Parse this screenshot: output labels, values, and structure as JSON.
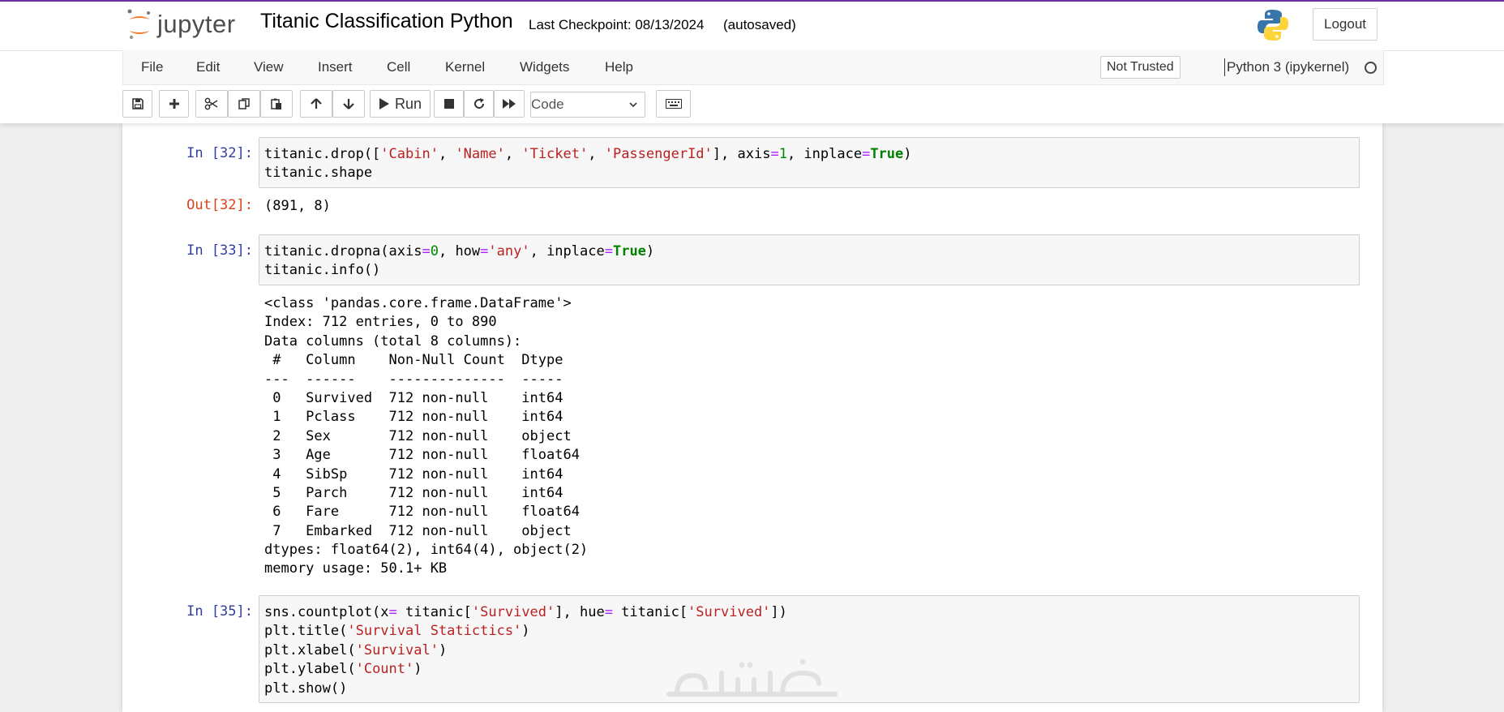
{
  "header": {
    "logo_text": "jupyter",
    "notebook_title": "Titanic Classification Python",
    "checkpoint": "Last Checkpoint: 08/13/2024",
    "save_status": "(autosaved)",
    "logout_label": "Logout"
  },
  "menu": {
    "items": [
      "File",
      "Edit",
      "View",
      "Insert",
      "Cell",
      "Kernel",
      "Widgets",
      "Help"
    ],
    "trust_label": "Not Trusted",
    "kernel_name": "Python 3 (ipykernel)"
  },
  "toolbar": {
    "run_label": "Run",
    "cell_type": "Code",
    "icons": [
      "save-icon",
      "plus-icon",
      "cut-icon",
      "copy-icon",
      "paste-icon",
      "arrow-up-icon",
      "arrow-down-icon",
      "run-icon",
      "stop-icon",
      "restart-icon",
      "fast-forward-icon",
      "keyboard-icon"
    ]
  },
  "cells": {
    "c32": {
      "in_prompt": "In [32]:",
      "code": {
        "l1": {
          "a": "titanic.drop([",
          "b": "'Cabin'",
          "c": ", ",
          "d": "'Name'",
          "e": ", ",
          "f": "'Ticket'",
          "g": ", ",
          "h": "'PassengerId'",
          "i": "], axis",
          "j": "=",
          "k": "1",
          "l": ", inplace",
          "m": "=",
          "n": "True",
          "o": ")"
        },
        "l2": "titanic.shape"
      },
      "out_prompt": "Out[32]:",
      "output": "(891, 8)"
    },
    "c33": {
      "in_prompt": "In [33]:",
      "code": {
        "l1": {
          "a": "titanic.dropna(axis",
          "b": "=",
          "c": "0",
          "d": ", how",
          "e": "=",
          "f": "'any'",
          "g": ", inplace",
          "h": "=",
          "i": "True",
          "j": ")"
        },
        "l2": "titanic.info()"
      },
      "output_lines": [
        "<class 'pandas.core.frame.DataFrame'>",
        "Index: 712 entries, 0 to 890",
        "Data columns (total 8 columns):",
        " #   Column    Non-Null Count  Dtype  ",
        "---  ------    --------------  -----  ",
        " 0   Survived  712 non-null    int64  ",
        " 1   Pclass    712 non-null    int64  ",
        " 2   Sex       712 non-null    object ",
        " 3   Age       712 non-null    float64",
        " 4   SibSp     712 non-null    int64  ",
        " 5   Parch     712 non-null    int64  ",
        " 6   Fare      712 non-null    float64",
        " 7   Embarked  712 non-null    object ",
        "dtypes: float64(2), int64(4), object(2)",
        "memory usage: 50.1+ KB"
      ]
    },
    "c35": {
      "in_prompt": "In [35]:",
      "code": {
        "l1": {
          "a": "sns.countplot(x",
          "b": "=",
          "c": " titanic[",
          "d": "'Survived'",
          "e": "], hue",
          "f": "=",
          "g": " titanic[",
          "h": "'Survived'",
          "i": "])"
        },
        "l2": {
          "a": "plt.title(",
          "b": "'Survival Statictics'",
          "c": ")"
        },
        "l3": {
          "a": "plt.xlabel(",
          "b": "'Survival'",
          "c": ")"
        },
        "l4": {
          "a": "plt.ylabel(",
          "b": "'Count'",
          "c": ")"
        },
        "l5": "plt.show()"
      }
    }
  },
  "colors": {
    "top_accent": "#6b2fa0",
    "string": "#ba2121",
    "number": "#008800",
    "operator": "#aa22ff",
    "keyword": "#008000",
    "in_prompt": "#303f9f",
    "out_prompt": "#d84315"
  },
  "watermark_text": "خمسات"
}
